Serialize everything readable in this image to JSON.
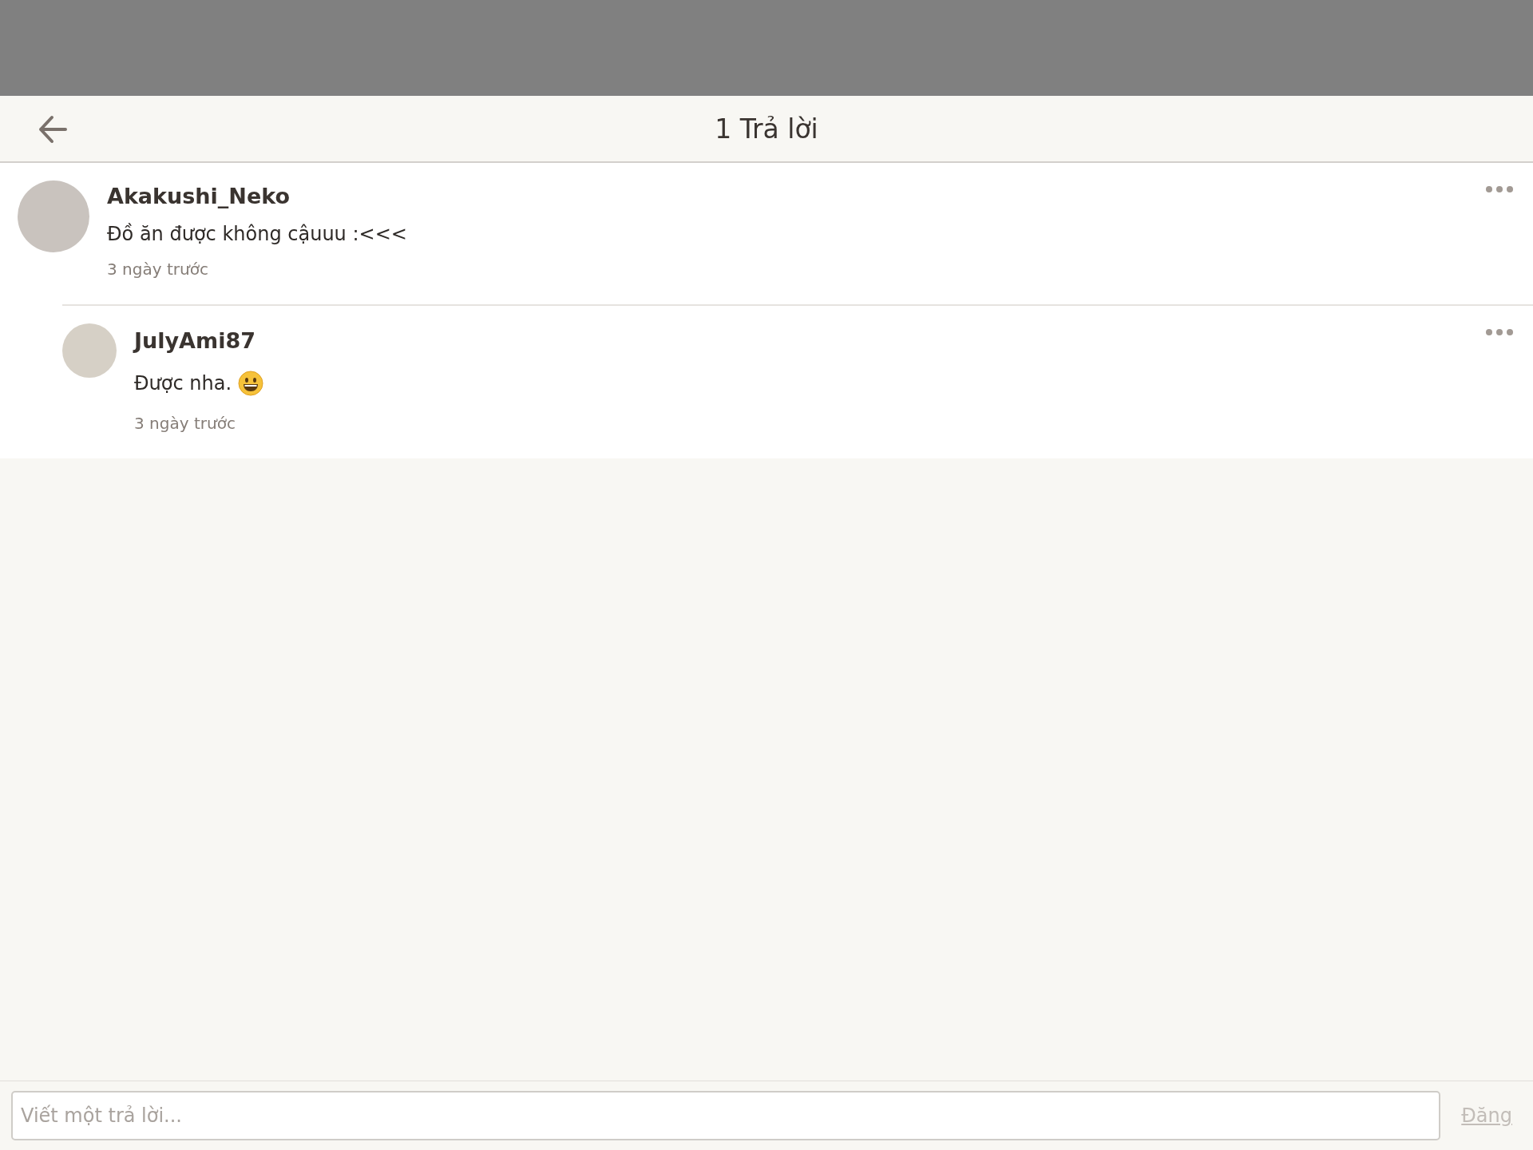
{
  "header": {
    "title": "1 Trả lời"
  },
  "comments": [
    {
      "kind": "comment",
      "author": "Akakushi_Neko",
      "text": "Đồ ăn được không cậuuu :<<<",
      "emoji": false,
      "time": "3 ngày trước"
    },
    {
      "kind": "reply",
      "author": "JulyAmi87",
      "text": "Được nha.",
      "emoji": true,
      "time": "3 ngày trước"
    }
  ],
  "composer": {
    "placeholder": "Viết một trả lời...",
    "post_button": {
      "label": "Đăng",
      "disabled": true
    }
  }
}
